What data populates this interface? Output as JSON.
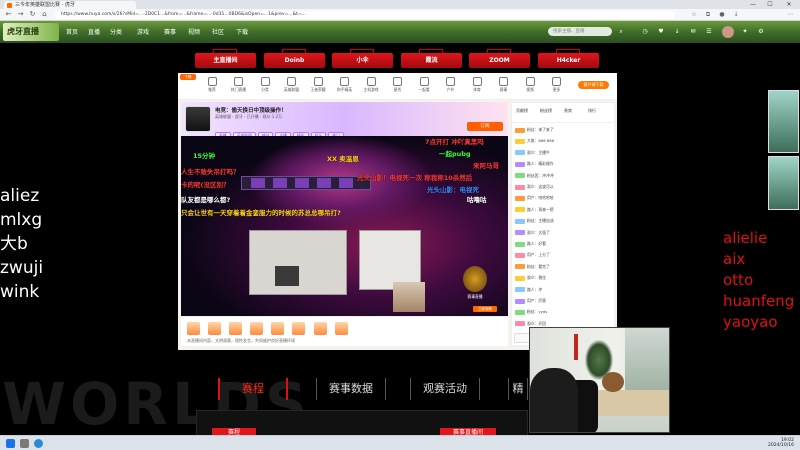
{
  "browser": {
    "tab_title": "三今年英雄联盟比赛 - 虎牙",
    "url": "https://www.huya.com/s/26?sMid=...-2D0C1...&from=...&frame=...-0d31...0BD6&isOpen=...1&prev=...&t=...",
    "win_minimize": "—",
    "win_maximize": "☐",
    "win_close": "✕"
  },
  "site": {
    "logo_text": "虎牙直播",
    "nav": [
      "首页",
      "直播",
      "分类",
      "游戏",
      "赛事",
      "视频",
      "社区",
      "下载"
    ],
    "search_placeholder": "搜索主播、直播"
  },
  "player_tabs": [
    "主直播间",
    "Doinb",
    "小伞",
    "霞流",
    "ZOOM",
    "H4cker"
  ],
  "left_names": [
    "aliez",
    "mlxg",
    "大b",
    "zwuji",
    "wink"
  ],
  "right_names": [
    "alielie",
    "aix",
    "otto",
    "huanfeng",
    "yaoyao"
  ],
  "inner": {
    "badge": "下载",
    "nav_labels": [
      "推荐",
      "热门直播",
      "分类",
      "英雄联盟",
      "王者荣耀",
      "和平精英",
      "主机游戏",
      "星秀",
      "一起看",
      "户外",
      "体育",
      "赛事",
      "视频",
      "更多"
    ],
    "download_button": "客户端下载",
    "stream_title": "电竞：偷天换日中顶级操作！",
    "stream_sub": "英雄联盟 · 虎牙 · 已开播 · 观众 1.2万",
    "stream_tags": [
      "直播",
      "英雄联盟",
      "峡谷",
      "主播",
      "精彩",
      "娱乐",
      "热门"
    ],
    "follow_button": "订阅",
    "overlay_logo_caption": "赛事直播",
    "overlay_button": "立即观看",
    "footer_line": "本直播间内容，文明观赛，理性发言，共同维护良好直播环境",
    "chat_tabs": [
      "贡献榜",
      "粉丝榜",
      "贵宾",
      "排行"
    ],
    "chat_send": "发送",
    "chat_rows": [
      "粉丝：来了来了",
      "大佬：666 666",
      "观众：主播牛",
      "路人：精彩操作",
      "粉丝团：冲冲冲",
      "观众：这波可以",
      "用户：哈哈哈哈",
      "路人：再来一把",
      "粉丝：主播加油",
      "观众：太强了",
      "路人：好看",
      "用户：上分了",
      "粉丝：看完了",
      "观众：稳住",
      "路人：冲",
      "用户：厉害",
      "粉丝：yyds",
      "观众：开团"
    ]
  },
  "danmu": [
    {
      "text": "15分钟",
      "color": "#3aff3a"
    },
    {
      "text": "人生不致失吊打吗？",
      "color": "#ff3a3a"
    },
    {
      "text": "卡的呢(没区别？",
      "color": "#ff3a3a"
    },
    {
      "text": "队友都是哪么都?",
      "color": "#ffffff"
    },
    {
      "text": "只会让世有一天穿着着金銮服力的时候的苏总总哪吊打?",
      "color": "#ffd21a"
    },
    {
      "text": "XX 卖温恩",
      "color": "#ffd21a"
    },
    {
      "text": "7点开打 冲吖真黑吗",
      "color": "#ff3a3a"
    },
    {
      "text": "一起pubg",
      "color": "#3aff3a"
    },
    {
      "text": "来阿马哥",
      "color": "#ff3a3a"
    },
    {
      "text": "光头山影！电视死一次 称我称10杀然后",
      "color": "#ff3a3a"
    },
    {
      "text": "光头山影：电视死",
      "color": "#3a8aff"
    },
    {
      "text": "咕噜咕",
      "color": "#ffffff"
    }
  ],
  "bottom": {
    "bg_text": "WORLDS",
    "tabs": [
      "赛程",
      "赛事数据",
      "观赛活动",
      "精"
    ],
    "btn_left": "赛程",
    "btn_right": "赛事直播间"
  },
  "taskbar": {
    "time": "19:02",
    "date": "2024/10/16"
  }
}
